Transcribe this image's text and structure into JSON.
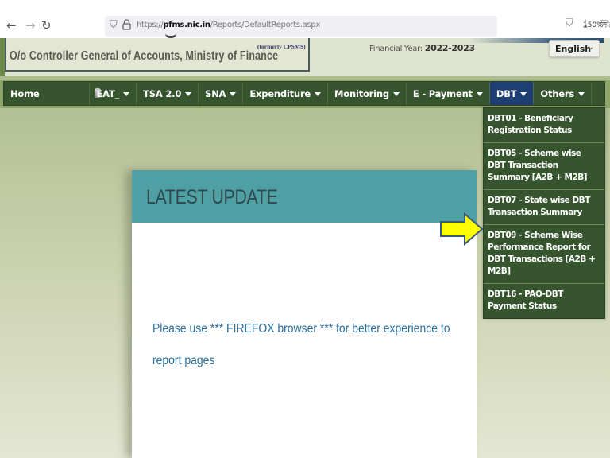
{
  "browser": {
    "back_icon": "arrow-left-icon",
    "forward_icon": "arrow-right-icon",
    "reload_icon": "reload-icon",
    "url_prefix": "https://",
    "url_domain": "pfms.nic.in",
    "url_path": "/Reports/DefaultReports.aspx",
    "zoom_level": "150%",
    "icons": [
      "shield-icon",
      "lock-icon",
      "star-icon",
      "pocket-icon",
      "download-icon",
      "menu-icon"
    ]
  },
  "header": {
    "org_title": "O/o Controller General of Accounts, Ministry of Finance",
    "formerly": "(formerly CPSMS)",
    "financial_year_label": "Financial Year:",
    "financial_year_value": "2022-2023",
    "language": {
      "selected": "English",
      "chevron": "⌄"
    }
  },
  "nav": {
    "items": [
      {
        "label": "Home",
        "dropdown": false
      },
      {
        "label": "EAT_",
        "dropdown": true
      },
      {
        "label": "TSA 2.0",
        "dropdown": true
      },
      {
        "label": "SNA",
        "dropdown": true
      },
      {
        "label": "Expenditure",
        "dropdown": true
      },
      {
        "label": "Monitoring",
        "dropdown": true
      },
      {
        "label": "E - Payment",
        "dropdown": true
      },
      {
        "label": "DBT",
        "dropdown": true,
        "active": true
      },
      {
        "label": "Others",
        "dropdown": true
      }
    ],
    "active_color": "#1f3f74",
    "bar_color": "#36552e"
  },
  "dbt_menu": {
    "items": [
      {
        "label": "DBT01 - Beneficiary Registration Status"
      },
      {
        "label": "DBT05 - Scheme wise DBT Transaction Summary [A2B + M2B]",
        "highlighted_by_arrow": true
      },
      {
        "label": "DBT07 - State wise DBT Transaction Summary"
      },
      {
        "label": "DBT09 - Scheme Wise Performance Report for DBT Transactions [A2B + M2B]"
      },
      {
        "label": "DBT16 - PAO-DBT Payment Status"
      }
    ]
  },
  "latest_update": {
    "title": "LATEST UPDATE",
    "message": "Please use *** FIREFOX browser *** for better experience to report pages",
    "header_color": "#4fa0a4"
  },
  "annotation": {
    "arrow_color": "#ffff00",
    "arrow_icon": "arrow-right-icon"
  }
}
